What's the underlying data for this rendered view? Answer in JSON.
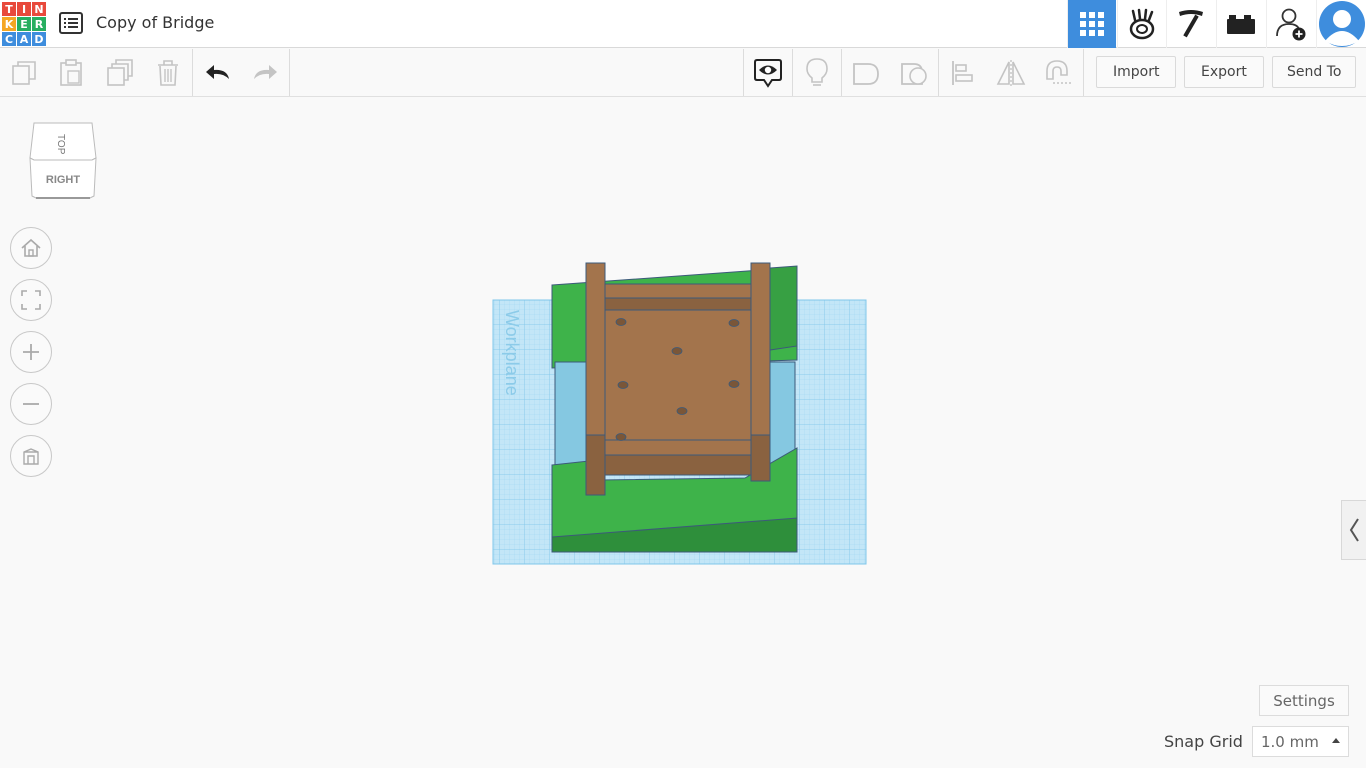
{
  "app": {
    "logo_letters": [
      "T",
      "I",
      "N",
      "K",
      "E",
      "R",
      "C",
      "A",
      "D"
    ],
    "logo_colors": [
      "#e8493b",
      "#e8493b",
      "#e8493b",
      "#f5a623",
      "#27ae60",
      "#27ae60",
      "#3e8ddd",
      "#3e8ddd",
      "#3e8ddd"
    ],
    "design_title": "Copy of Bridge"
  },
  "topbar_icons": [
    {
      "name": "3d-design-grid-icon",
      "active": true
    },
    {
      "name": "codeblocks-icon",
      "active": false
    },
    {
      "name": "minecraft-pickaxe-icon",
      "active": false
    },
    {
      "name": "lego-brick-icon",
      "active": false
    },
    {
      "name": "add-user-icon",
      "active": false
    },
    {
      "name": "avatar-icon",
      "active": false
    }
  ],
  "toolbar": {
    "left_tools": [
      "copy-icon",
      "paste-icon",
      "duplicate-icon",
      "delete-icon",
      "undo-icon",
      "redo-icon"
    ],
    "right_tools": [
      "notes-eye-icon",
      "lightbulb-icon",
      "solid-shape-icon",
      "hole-shape-icon",
      "align-icon",
      "mirror-icon",
      "magnet-icon"
    ],
    "import_label": "Import",
    "export_label": "Export",
    "send_to_label": "Send To"
  },
  "viewcube": {
    "top_face": "TOP",
    "front_face": "RIGHT"
  },
  "nav_buttons": [
    "home-view-icon",
    "fit-all-icon",
    "zoom-in-icon",
    "zoom-out-icon",
    "perspective-icon"
  ],
  "workplane": {
    "label": "Workplane"
  },
  "bottom": {
    "settings_label": "Settings",
    "snap_grid_label": "Snap Grid",
    "snap_grid_value": "1.0 mm"
  },
  "colors": {
    "accent": "#3e8ddd",
    "workplane": "#c3e6f7",
    "grid_line": "#7fc6ea",
    "green": "#3eb34a",
    "green_dark": "#2e8f3b",
    "brown": "#a3744c",
    "water": "#85c8e1"
  }
}
